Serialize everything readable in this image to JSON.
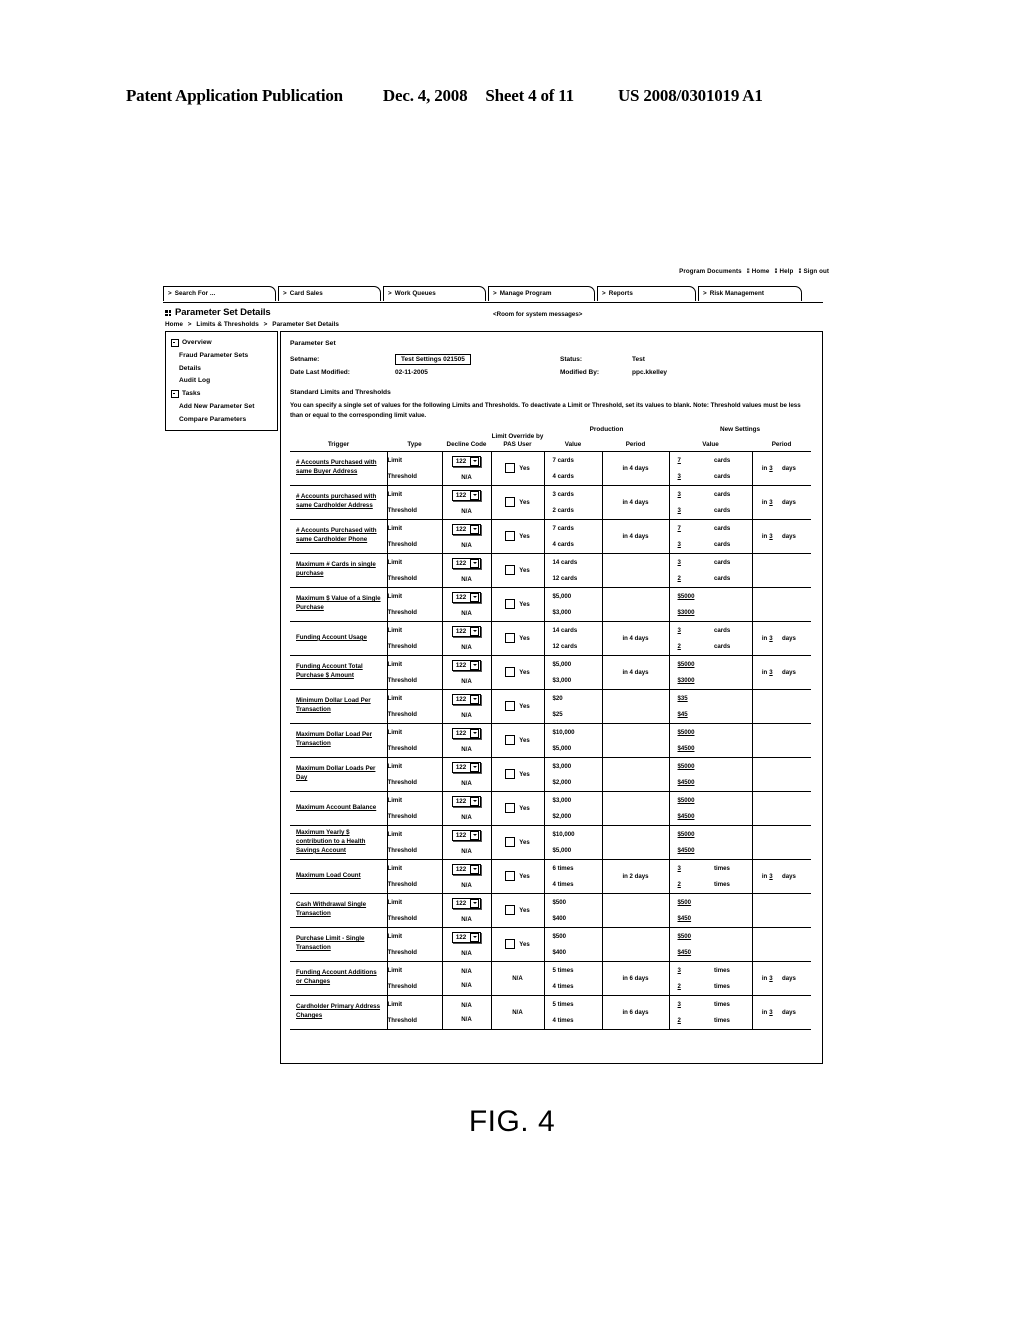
{
  "patent_header": {
    "publication": "Patent Application Publication",
    "date": "Dec. 4, 2008",
    "sheet": "Sheet 4 of 11",
    "number": "US 2008/0301019 A1"
  },
  "figure_caption": "FIG. 4",
  "utility_links": {
    "program_documents": "Program Documents",
    "home": "Home",
    "help": "Help",
    "sign_out": "Sign out"
  },
  "tabs": [
    {
      "label": "Search For ...",
      "chevron": ">"
    },
    {
      "label": "Card Sales",
      "chevron": ">"
    },
    {
      "label": "Work Queues",
      "chevron": ">"
    },
    {
      "label": "Manage Program",
      "chevron": ">"
    },
    {
      "label": "Reports",
      "chevron": ">"
    },
    {
      "label": "Risk Management",
      "chevron": ">"
    }
  ],
  "page": {
    "title": "Parameter Set Details",
    "breadcrumb": {
      "home": "Home",
      "sep1": ">",
      "limits": "Limits & Thresholds",
      "sep2": ">",
      "current": "Parameter Set Details"
    },
    "system_message": "<Room  for system messages>"
  },
  "sidebar": {
    "items": [
      {
        "label": "Overview",
        "expander": true
      },
      {
        "label": "Fraud Parameter Sets",
        "expander": false
      },
      {
        "label": "Details",
        "expander": false
      },
      {
        "label": "Audit Log",
        "expander": false
      },
      {
        "label": "Tasks",
        "expander": true
      },
      {
        "label": "Add New Parameter Set",
        "expander": false
      },
      {
        "label": "Compare Parameters",
        "expander": false
      }
    ]
  },
  "parameter_set": {
    "section_label": "Parameter Set",
    "setname_label": "Setname:",
    "setname_value": "Test Settings 021505",
    "date_label": "Date Last Modified:",
    "date_value": "02-11-2005",
    "status_label": "Status:",
    "status_value": "Test",
    "modified_by_label": "Modified By:",
    "modified_by_value": "ppc.kkelley"
  },
  "standard_limits": {
    "heading": "Standard Limits and Thresholds",
    "description": "You can specify a single set of values for the following Limits and Thresholds. To deactivate a Limit or Threshold, set its values to blank. Note: Threshold values must be less than or equal to the corresponding limit value."
  },
  "table": {
    "headers": {
      "trigger": "Trigger",
      "type": "Type",
      "decline_code": "Decline Code",
      "limit_override": "Limit Override by PAS User",
      "production_group": "Production",
      "new_settings_group": "New Settings",
      "production_value": "Value",
      "production_period": "Period",
      "new_value": "Value",
      "new_period": "Period"
    },
    "type_limit": "Limit",
    "type_threshold": "Threshold",
    "na": "N/A",
    "yes_label": "Yes",
    "decline_code_value": "122",
    "rows": [
      {
        "trigger": "# Accounts Purchased with same Buyer Address",
        "decline_code": "122",
        "override": "checkbox",
        "limit": {
          "prod_value": "7 cards",
          "new_value": "7",
          "new_unit": "cards"
        },
        "threshold": {
          "prod_value": "4 cards",
          "new_value": "3",
          "new_unit": "cards"
        },
        "prod_period": "in 4 days",
        "new_period_prefix": "in",
        "new_period_num": "3",
        "new_period_unit": "days"
      },
      {
        "trigger": "# Accounts purchased with same Cardholder Address",
        "decline_code": "122",
        "override": "checkbox",
        "limit": {
          "prod_value": "3 cards",
          "new_value": "3",
          "new_unit": "cards"
        },
        "threshold": {
          "prod_value": "2 cards",
          "new_value": "3",
          "new_unit": "cards"
        },
        "prod_period": "in 4 days",
        "new_period_prefix": "in",
        "new_period_num": "3",
        "new_period_unit": "days"
      },
      {
        "trigger": "# Accounts Purchased with same Cardholder Phone",
        "decline_code": "122",
        "override": "checkbox",
        "limit": {
          "prod_value": "7 cards",
          "new_value": "7",
          "new_unit": "cards"
        },
        "threshold": {
          "prod_value": "4 cards",
          "new_value": "3",
          "new_unit": "cards"
        },
        "prod_period": "in 4 days",
        "new_period_prefix": "in",
        "new_period_num": "3",
        "new_period_unit": "days"
      },
      {
        "trigger": "Maximum # Cards in single purchase",
        "decline_code": "122",
        "override": "checkbox",
        "limit": {
          "prod_value": "14 cards",
          "new_value": "3",
          "new_unit": "cards"
        },
        "threshold": {
          "prod_value": "12 cards",
          "new_value": "2",
          "new_unit": "cards"
        },
        "prod_period": "",
        "new_period_prefix": "",
        "new_period_num": "",
        "new_period_unit": ""
      },
      {
        "trigger": "Maximum $ Value of a Single Purchase",
        "decline_code": "122",
        "override": "checkbox",
        "limit": {
          "prod_value": "$5,000",
          "new_value": "$5000",
          "new_unit": ""
        },
        "threshold": {
          "prod_value": "$3,000",
          "new_value": "$3000",
          "new_unit": ""
        },
        "prod_period": "",
        "new_period_prefix": "",
        "new_period_num": "",
        "new_period_unit": ""
      },
      {
        "trigger": "Funding Account Usage",
        "decline_code": "122",
        "override": "checkbox",
        "limit": {
          "prod_value": "14 cards",
          "new_value": "3",
          "new_unit": "cards"
        },
        "threshold": {
          "prod_value": "12 cards",
          "new_value": "2",
          "new_unit": "cards"
        },
        "prod_period": "in 4 days",
        "new_period_prefix": "in",
        "new_period_num": "3",
        "new_period_unit": "days"
      },
      {
        "trigger": "Funding Account Total Purchase $ Amount",
        "decline_code": "122",
        "override": "checkbox",
        "limit": {
          "prod_value": "$5,000",
          "new_value": "$5000",
          "new_unit": ""
        },
        "threshold": {
          "prod_value": "$3,000",
          "new_value": "$3000",
          "new_unit": ""
        },
        "prod_period": "in 4 days",
        "new_period_prefix": "in",
        "new_period_num": "3",
        "new_period_unit": "days"
      },
      {
        "trigger": "Minimum Dollar Load Per Transaction",
        "decline_code": "122",
        "override": "checkbox",
        "limit": {
          "prod_value": "$20",
          "new_value": "$35",
          "new_unit": ""
        },
        "threshold": {
          "prod_value": "$25",
          "new_value": "$45",
          "new_unit": ""
        },
        "prod_period": "",
        "new_period_prefix": "",
        "new_period_num": "",
        "new_period_unit": ""
      },
      {
        "trigger": "Maximum Dollar Load Per Transaction",
        "decline_code": "122",
        "override": "checkbox",
        "limit": {
          "prod_value": "$10,000",
          "new_value": "$5000",
          "new_unit": ""
        },
        "threshold": {
          "prod_value": "$5,000",
          "new_value": "$4500",
          "new_unit": ""
        },
        "prod_period": "",
        "new_period_prefix": "",
        "new_period_num": "",
        "new_period_unit": ""
      },
      {
        "trigger": "Maximum Dollar Loads Per Day",
        "decline_code": "122",
        "override": "checkbox",
        "limit": {
          "prod_value": "$3,000",
          "new_value": "$5000",
          "new_unit": ""
        },
        "threshold": {
          "prod_value": "$2,000",
          "new_value": "$4500",
          "new_unit": ""
        },
        "prod_period": "",
        "new_period_prefix": "",
        "new_period_num": "",
        "new_period_unit": ""
      },
      {
        "trigger": "Maximum Account Balance",
        "decline_code": "122",
        "override": "checkbox",
        "limit": {
          "prod_value": "$3,000",
          "new_value": "$5000",
          "new_unit": ""
        },
        "threshold": {
          "prod_value": "$2,000",
          "new_value": "$4500",
          "new_unit": ""
        },
        "prod_period": "",
        "new_period_prefix": "",
        "new_period_num": "",
        "new_period_unit": ""
      },
      {
        "trigger": "Maximum Yearly $ contribution to a Health Savings Account",
        "decline_code": "122",
        "override": "checkbox",
        "limit": {
          "prod_value": "$10,000",
          "new_value": "$5000",
          "new_unit": ""
        },
        "threshold": {
          "prod_value": "$5,000",
          "new_value": "$4500",
          "new_unit": ""
        },
        "prod_period": "",
        "new_period_prefix": "",
        "new_period_num": "",
        "new_period_unit": ""
      },
      {
        "trigger": "Maximum Load Count",
        "decline_code": "122",
        "override": "checkbox",
        "limit": {
          "prod_value": "6 times",
          "new_value": "3",
          "new_unit": "times"
        },
        "threshold": {
          "prod_value": "4 times",
          "new_value": "2",
          "new_unit": "times"
        },
        "prod_period": "in 2 days",
        "new_period_prefix": "in",
        "new_period_num": "3",
        "new_period_unit": "days"
      },
      {
        "trigger": "Cash Withdrawal Single Transaction",
        "decline_code": "122",
        "override": "checkbox",
        "limit": {
          "prod_value": "$500",
          "new_value": "$500",
          "new_unit": ""
        },
        "threshold": {
          "prod_value": "$400",
          "new_value": "$450",
          "new_unit": ""
        },
        "prod_period": "",
        "new_period_prefix": "",
        "new_period_num": "",
        "new_period_unit": ""
      },
      {
        "trigger": "Purchase Limit - Single Transaction",
        "decline_code": "122",
        "override": "checkbox",
        "limit": {
          "prod_value": "$500",
          "new_value": "$500",
          "new_unit": ""
        },
        "threshold": {
          "prod_value": "$400",
          "new_value": "$450",
          "new_unit": ""
        },
        "prod_period": "",
        "new_period_prefix": "",
        "new_period_num": "",
        "new_period_unit": ""
      },
      {
        "trigger": "Funding Account Additions or Changes",
        "decline_code": "N/A",
        "override": "na",
        "limit": {
          "prod_value": "5 times",
          "new_value": "3",
          "new_unit": "times"
        },
        "threshold": {
          "prod_value": "4 times",
          "new_value": "2",
          "new_unit": "times"
        },
        "prod_period": "in 6 days",
        "new_period_prefix": "in",
        "new_period_num": "3",
        "new_period_unit": "days"
      },
      {
        "trigger": "Cardholder Primary Address Changes",
        "decline_code": "N/A",
        "override": "na",
        "limit": {
          "prod_value": "5 times",
          "new_value": "3",
          "new_unit": "times"
        },
        "threshold": {
          "prod_value": "4 times",
          "new_value": "2",
          "new_unit": "times"
        },
        "prod_period": "in 6 days",
        "new_period_prefix": "in",
        "new_period_num": "3",
        "new_period_unit": "days"
      }
    ]
  }
}
